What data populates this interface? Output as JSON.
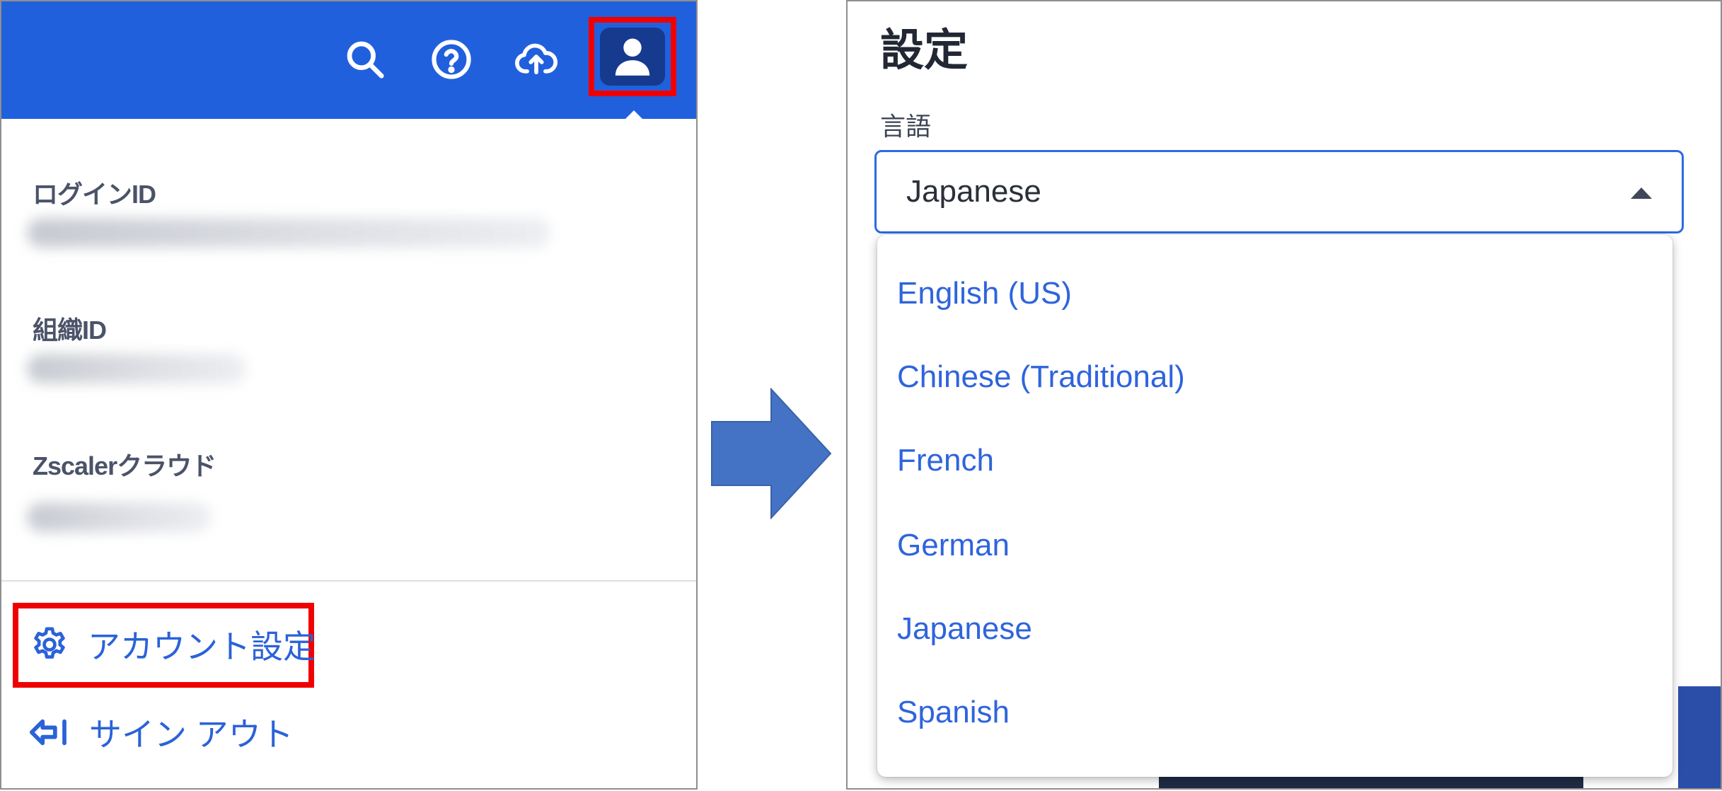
{
  "left": {
    "header_icons": [
      "search-icon",
      "help-icon",
      "cloud-upload-icon",
      "user-icon"
    ],
    "info": [
      {
        "label": "ログインID"
      },
      {
        "label": "組織ID"
      },
      {
        "label": "Zscalerクラウド"
      }
    ],
    "account_settings_label": "アカウント設定",
    "sign_out_label": "サイン アウト"
  },
  "right": {
    "title": "設定",
    "language_label": "言語",
    "selected_language": "Japanese",
    "options": [
      "English (US)",
      "Chinese (Traditional)",
      "French",
      "German",
      "Japanese",
      "Spanish"
    ]
  },
  "colors": {
    "header_blue": "#2160dd",
    "avatar_bg": "#163a8d",
    "highlight_red": "#f00000",
    "link_blue": "#2a62d8",
    "arrow_blue": "#4472c4"
  }
}
